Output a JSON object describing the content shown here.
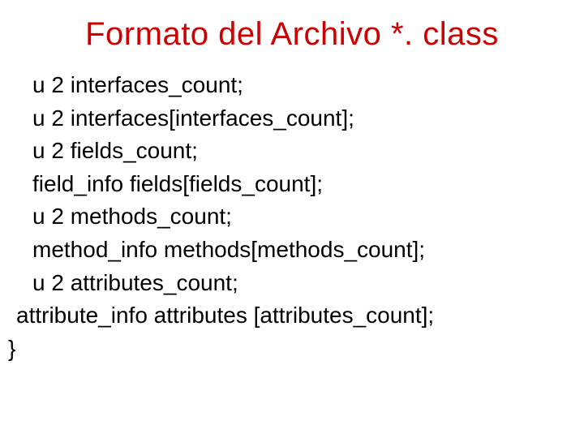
{
  "title": "Formato del Archivo *. class",
  "code_lines": [
    {
      "text": "u 2 interfaces_count;",
      "indent": "indent-1"
    },
    {
      "text": "u 2 interfaces[interfaces_count];",
      "indent": "indent-1"
    },
    {
      "text": "u 2 fields_count;",
      "indent": "indent-1"
    },
    {
      "text": "field_info fields[fields_count];",
      "indent": "indent-1"
    },
    {
      "text": "u 2 methods_count;",
      "indent": "indent-1"
    },
    {
      "text": "method_info methods[methods_count];",
      "indent": "indent-1"
    },
    {
      "text": "u 2 attributes_count;",
      "indent": "indent-1"
    },
    {
      "text": "attribute_info attributes [attributes_count];",
      "indent": "indent-0"
    },
    {
      "text": "}",
      "indent": "no-indent"
    }
  ]
}
